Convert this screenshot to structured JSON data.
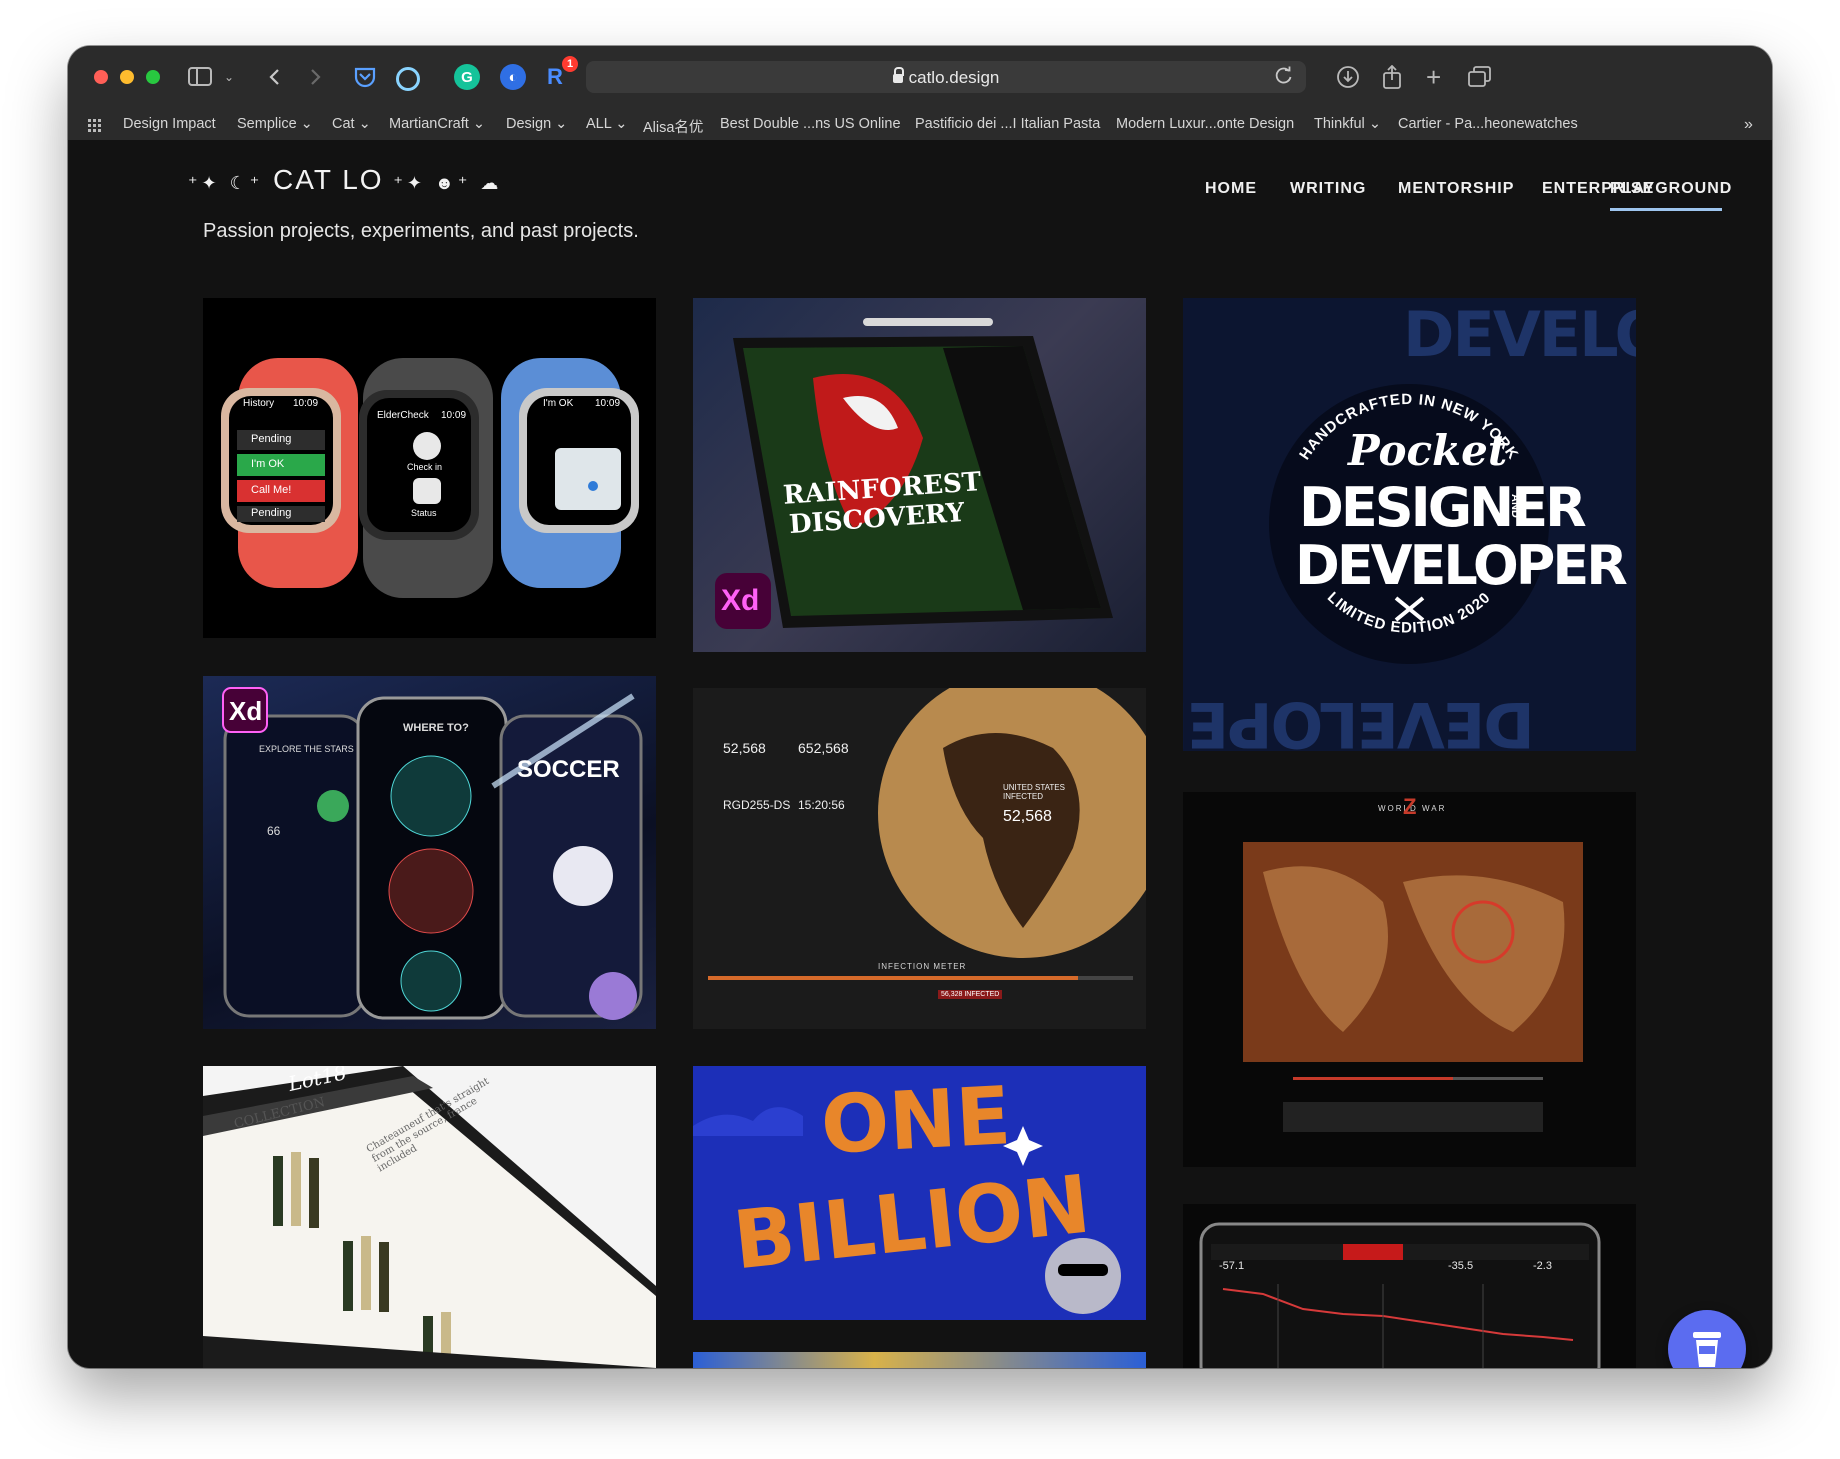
{
  "browser": {
    "url": "catlo.design",
    "extension_badge": "1",
    "bookmarks": [
      "Design Impact",
      "Semplice",
      "Cat",
      "MartianCraft",
      "Design",
      "ALL",
      "Alisa名优",
      "Best Double ...ns US Online",
      "Pastificio dei ...I Italian Pasta",
      "Modern Luxur...onte Design",
      "Thinkful",
      "Cartier - Pa...heonewatches"
    ]
  },
  "site": {
    "logo_text": "CAT LO",
    "nav": [
      "HOME",
      "WRITING",
      "MENTORSHIP",
      "ENTERPRISE",
      "PLAYGROUND"
    ],
    "active_nav": "PLAYGROUND",
    "tagline": "Passion projects, experiments, and past projects."
  },
  "cards": {
    "watch": {
      "left_title": "History",
      "left_time": "10:09",
      "left_rows": [
        "Pending",
        "I'm OK",
        "Call Me!",
        "Pending"
      ],
      "center_title": "ElderCheck",
      "center_time": "10:09",
      "center_labels": [
        "Check in",
        "Status"
      ],
      "right_title": "I'm OK",
      "right_time": "10:09"
    },
    "rainforest": {
      "title_line1": "RAINFOREST",
      "title_line2": "DISCOVERY",
      "badge": "Xd"
    },
    "pocket": {
      "arc_top": "HANDCRAFTED IN NEW YORK",
      "script": "Pocket",
      "line1": "DESIGNER",
      "and": "AND",
      "line2": "DEVELOPER",
      "arc_bottom": "LIMITED EDITION 2020",
      "bg_word": "DEVELOPER"
    },
    "space": {
      "badge": "Xd",
      "screen1": "EXPLORE THE STARS",
      "screen2": "WHERE TO?",
      "screen3": "SOCCER",
      "planet": "66"
    },
    "infection": {
      "stats": [
        "52,568",
        "652,568",
        "RGD255-DS",
        "15:20:56"
      ],
      "map_label": "UNITED STATES INFECTED",
      "map_value": "52,568",
      "meter": "INFECTION METER",
      "meter_value": "56,328 INFECTED"
    },
    "wwz": {
      "title": "WORLD WAR",
      "letter": "Z"
    },
    "wine": {
      "brand": "Lot18",
      "collection": "COLLECTION",
      "text": "Chateauneuf that's straight from the source, france included"
    },
    "billion": {
      "line1": "ONE",
      "line2": "BILLION"
    },
    "trading": {
      "values": [
        "-57.1",
        "-35.5",
        "-2.3"
      ]
    }
  }
}
